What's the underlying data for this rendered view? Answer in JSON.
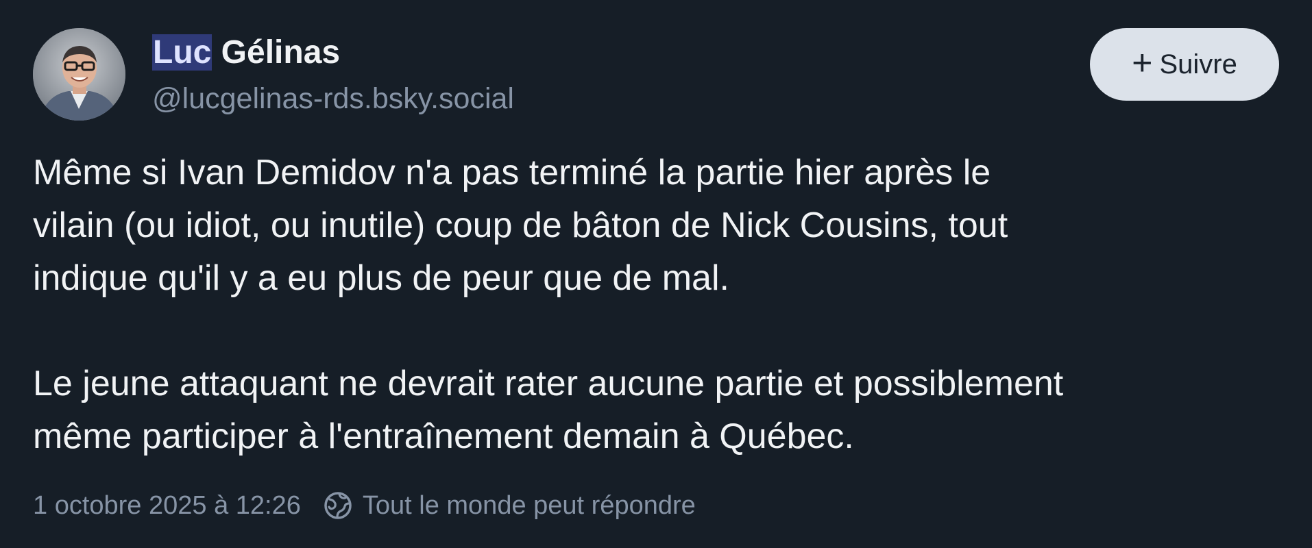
{
  "author": {
    "name_highlight": "Luc",
    "name_rest": " Gélinas",
    "handle": "@lucgelinas-rds.bsky.social",
    "avatar_icon": "avatar-photo"
  },
  "follow_button": {
    "icon": "plus-icon",
    "plus_glyph": "+",
    "label": "Suivre"
  },
  "post": {
    "paragraph1_lines": [
      "Même si Ivan Demidov n'a pas terminé la partie hier après le",
      "vilain (ou idiot, ou inutile) coup de bâton de Nick Cousins, tout",
      "indique qu'il y a eu plus de peur que de mal."
    ],
    "paragraph2_lines": [
      "Le jeune attaquant ne devrait rater aucune partie et possiblement",
      "même participer à l'entraînement demain à Québec."
    ]
  },
  "meta": {
    "timestamp": "1 octobre 2025 à 12:26",
    "reply_icon": "globe-icon",
    "reply_setting": "Tout le monde peut répondre"
  },
  "colors": {
    "background": "#161e27",
    "text": "#f1f3f5",
    "muted": "#8794a6",
    "highlight_bg": "#2f3a78",
    "button_bg": "#dce2ea"
  }
}
